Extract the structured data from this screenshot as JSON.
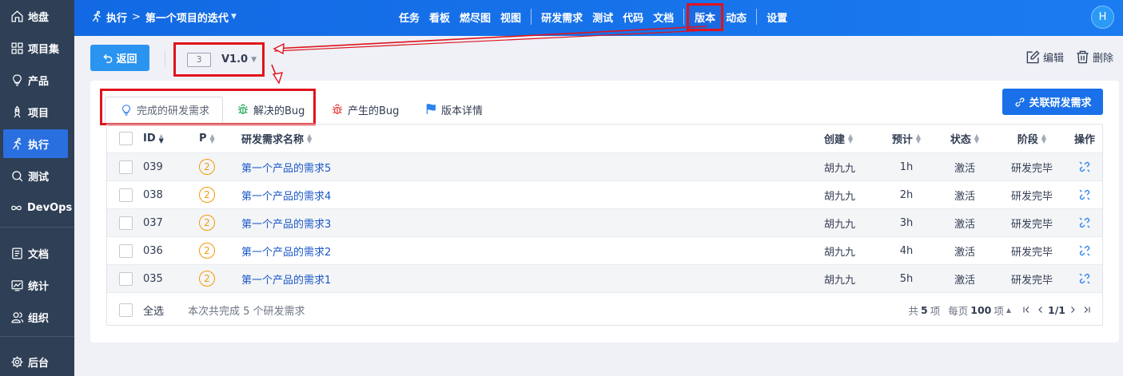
{
  "sidebar": {
    "items": [
      {
        "label": "地盘",
        "icon": "home-icon"
      },
      {
        "label": "项目集",
        "icon": "grid-icon"
      },
      {
        "label": "产品",
        "icon": "lightbulb-icon"
      },
      {
        "label": "项目",
        "icon": "rocket-icon"
      },
      {
        "label": "执行",
        "icon": "running-icon"
      },
      {
        "label": "测试",
        "icon": "search-icon"
      },
      {
        "label": "DevOps",
        "icon": "infinity-icon"
      },
      {
        "label": "文档",
        "icon": "document-icon"
      },
      {
        "label": "统计",
        "icon": "chart-icon"
      },
      {
        "label": "组织",
        "icon": "people-icon"
      },
      {
        "label": "后台",
        "icon": "gear-icon"
      }
    ],
    "active_index": 4
  },
  "topbar": {
    "module": "执行",
    "separator": ">",
    "execution": "第一个项目的迭代",
    "nav": [
      "任务",
      "看板",
      "燃尽图",
      "视图",
      "研发需求",
      "测试",
      "代码",
      "文档",
      "版本",
      "动态",
      "设置"
    ],
    "active_nav": "版本",
    "avatar": "H"
  },
  "toolbar": {
    "back_label": "返回",
    "version_number": "3",
    "version_name": "V1.0",
    "edit_label": "编辑",
    "delete_label": "删除"
  },
  "tabs": {
    "completed_stories": "完成的研发需求",
    "resolved_bugs": "解决的Bug",
    "created_bugs": "产生的Bug",
    "details": "版本详情"
  },
  "link_stories_label": "关联研发需求",
  "table": {
    "headers": {
      "id": "ID",
      "pri": "P",
      "title": "研发需求名称",
      "opened_by": "创建",
      "estimate": "预计",
      "status": "状态",
      "stage": "阶段",
      "actions": "操作"
    },
    "rows": [
      {
        "id": "039",
        "pri": "2",
        "title": "第一个产品的需求5",
        "opened_by": "胡九九",
        "estimate": "1h",
        "status": "激活",
        "stage": "研发完毕"
      },
      {
        "id": "038",
        "pri": "2",
        "title": "第一个产品的需求4",
        "opened_by": "胡九九",
        "estimate": "2h",
        "status": "激活",
        "stage": "研发完毕"
      },
      {
        "id": "037",
        "pri": "2",
        "title": "第一个产品的需求3",
        "opened_by": "胡九九",
        "estimate": "3h",
        "status": "激活",
        "stage": "研发完毕"
      },
      {
        "id": "036",
        "pri": "2",
        "title": "第一个产品的需求2",
        "opened_by": "胡九九",
        "estimate": "4h",
        "status": "激活",
        "stage": "研发完毕"
      },
      {
        "id": "035",
        "pri": "2",
        "title": "第一个产品的需求1",
        "opened_by": "胡九九",
        "estimate": "5h",
        "status": "激活",
        "stage": "研发完毕"
      }
    ],
    "footer": {
      "select_all": "全选",
      "summary": "本次共完成 5 个研发需求",
      "total_prefix": "共",
      "total": "5",
      "total_suffix": "项",
      "per_page_prefix": "每页",
      "per_page": "100",
      "per_page_suffix": "项",
      "page": "1/1"
    }
  },
  "colors": {
    "sidebar_bg": "#2e3f56",
    "topbar": "#1b7bf0",
    "accent": "#1a70e8",
    "annotation": "#e0131c",
    "priority": "#f19a09"
  }
}
